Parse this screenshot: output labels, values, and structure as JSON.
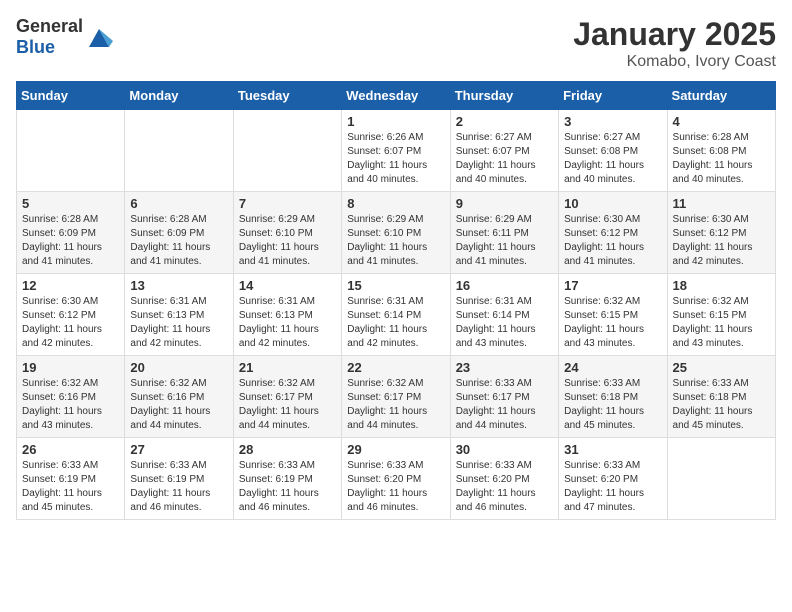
{
  "logo": {
    "general": "General",
    "blue": "Blue"
  },
  "title": {
    "month": "January 2025",
    "location": "Komabo, Ivory Coast"
  },
  "weekdays": [
    "Sunday",
    "Monday",
    "Tuesday",
    "Wednesday",
    "Thursday",
    "Friday",
    "Saturday"
  ],
  "weeks": [
    [
      {
        "day": null
      },
      {
        "day": null
      },
      {
        "day": null
      },
      {
        "day": "1",
        "sunrise": "6:26 AM",
        "sunset": "6:07 PM",
        "daylight": "11 hours and 40 minutes."
      },
      {
        "day": "2",
        "sunrise": "6:27 AM",
        "sunset": "6:07 PM",
        "daylight": "11 hours and 40 minutes."
      },
      {
        "day": "3",
        "sunrise": "6:27 AM",
        "sunset": "6:08 PM",
        "daylight": "11 hours and 40 minutes."
      },
      {
        "day": "4",
        "sunrise": "6:28 AM",
        "sunset": "6:08 PM",
        "daylight": "11 hours and 40 minutes."
      }
    ],
    [
      {
        "day": "5",
        "sunrise": "6:28 AM",
        "sunset": "6:09 PM",
        "daylight": "11 hours and 41 minutes."
      },
      {
        "day": "6",
        "sunrise": "6:28 AM",
        "sunset": "6:09 PM",
        "daylight": "11 hours and 41 minutes."
      },
      {
        "day": "7",
        "sunrise": "6:29 AM",
        "sunset": "6:10 PM",
        "daylight": "11 hours and 41 minutes."
      },
      {
        "day": "8",
        "sunrise": "6:29 AM",
        "sunset": "6:10 PM",
        "daylight": "11 hours and 41 minutes."
      },
      {
        "day": "9",
        "sunrise": "6:29 AM",
        "sunset": "6:11 PM",
        "daylight": "11 hours and 41 minutes."
      },
      {
        "day": "10",
        "sunrise": "6:30 AM",
        "sunset": "6:12 PM",
        "daylight": "11 hours and 41 minutes."
      },
      {
        "day": "11",
        "sunrise": "6:30 AM",
        "sunset": "6:12 PM",
        "daylight": "11 hours and 42 minutes."
      }
    ],
    [
      {
        "day": "12",
        "sunrise": "6:30 AM",
        "sunset": "6:12 PM",
        "daylight": "11 hours and 42 minutes."
      },
      {
        "day": "13",
        "sunrise": "6:31 AM",
        "sunset": "6:13 PM",
        "daylight": "11 hours and 42 minutes."
      },
      {
        "day": "14",
        "sunrise": "6:31 AM",
        "sunset": "6:13 PM",
        "daylight": "11 hours and 42 minutes."
      },
      {
        "day": "15",
        "sunrise": "6:31 AM",
        "sunset": "6:14 PM",
        "daylight": "11 hours and 42 minutes."
      },
      {
        "day": "16",
        "sunrise": "6:31 AM",
        "sunset": "6:14 PM",
        "daylight": "11 hours and 43 minutes."
      },
      {
        "day": "17",
        "sunrise": "6:32 AM",
        "sunset": "6:15 PM",
        "daylight": "11 hours and 43 minutes."
      },
      {
        "day": "18",
        "sunrise": "6:32 AM",
        "sunset": "6:15 PM",
        "daylight": "11 hours and 43 minutes."
      }
    ],
    [
      {
        "day": "19",
        "sunrise": "6:32 AM",
        "sunset": "6:16 PM",
        "daylight": "11 hours and 43 minutes."
      },
      {
        "day": "20",
        "sunrise": "6:32 AM",
        "sunset": "6:16 PM",
        "daylight": "11 hours and 44 minutes."
      },
      {
        "day": "21",
        "sunrise": "6:32 AM",
        "sunset": "6:17 PM",
        "daylight": "11 hours and 44 minutes."
      },
      {
        "day": "22",
        "sunrise": "6:32 AM",
        "sunset": "6:17 PM",
        "daylight": "11 hours and 44 minutes."
      },
      {
        "day": "23",
        "sunrise": "6:33 AM",
        "sunset": "6:17 PM",
        "daylight": "11 hours and 44 minutes."
      },
      {
        "day": "24",
        "sunrise": "6:33 AM",
        "sunset": "6:18 PM",
        "daylight": "11 hours and 45 minutes."
      },
      {
        "day": "25",
        "sunrise": "6:33 AM",
        "sunset": "6:18 PM",
        "daylight": "11 hours and 45 minutes."
      }
    ],
    [
      {
        "day": "26",
        "sunrise": "6:33 AM",
        "sunset": "6:19 PM",
        "daylight": "11 hours and 45 minutes."
      },
      {
        "day": "27",
        "sunrise": "6:33 AM",
        "sunset": "6:19 PM",
        "daylight": "11 hours and 46 minutes."
      },
      {
        "day": "28",
        "sunrise": "6:33 AM",
        "sunset": "6:19 PM",
        "daylight": "11 hours and 46 minutes."
      },
      {
        "day": "29",
        "sunrise": "6:33 AM",
        "sunset": "6:20 PM",
        "daylight": "11 hours and 46 minutes."
      },
      {
        "day": "30",
        "sunrise": "6:33 AM",
        "sunset": "6:20 PM",
        "daylight": "11 hours and 46 minutes."
      },
      {
        "day": "31",
        "sunrise": "6:33 AM",
        "sunset": "6:20 PM",
        "daylight": "11 hours and 47 minutes."
      },
      {
        "day": null
      }
    ]
  ],
  "labels": {
    "sunrise": "Sunrise:",
    "sunset": "Sunset:",
    "daylight": "Daylight:"
  }
}
